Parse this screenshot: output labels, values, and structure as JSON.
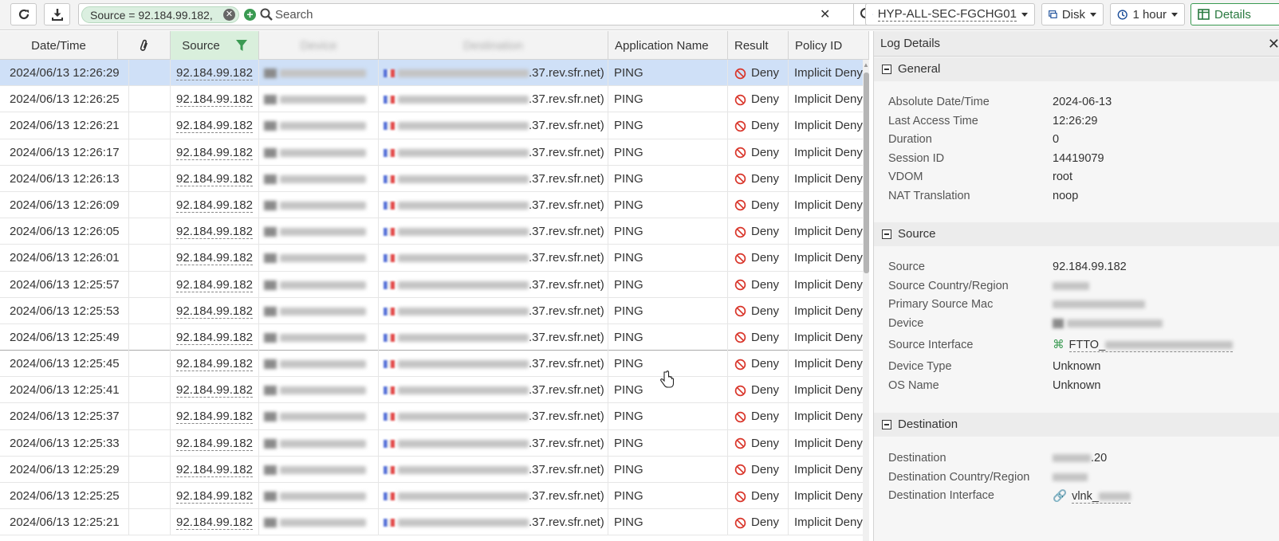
{
  "toolbar": {
    "refresh_icon": "refresh-icon",
    "download_icon": "download-icon",
    "filter_chip": "Source = 92.184.99.182,",
    "search_placeholder": "Search",
    "device_dropdown": "HYP-ALL-SEC-FGCHG01",
    "storage_dropdown": "Disk",
    "time_dropdown": "1 hour",
    "details_button": "Details"
  },
  "table": {
    "columns": {
      "date": "Date/Time",
      "source": "Source",
      "device": "Device",
      "destination": "Destination",
      "application": "Application Name",
      "result": "Result",
      "policy": "Policy ID"
    },
    "rows": [
      {
        "date": "2024/06/13 12:26:29",
        "source": "92.184.99.182",
        "dst_suffix": ".37.rev.sfr.net)",
        "app": "PING",
        "result": "Deny",
        "policy": "Implicit Deny"
      },
      {
        "date": "2024/06/13 12:26:25",
        "source": "92.184.99.182",
        "dst_suffix": ".37.rev.sfr.net)",
        "app": "PING",
        "result": "Deny",
        "policy": "Implicit Deny"
      },
      {
        "date": "2024/06/13 12:26:21",
        "source": "92.184.99.182",
        "dst_suffix": ".37.rev.sfr.net)",
        "app": "PING",
        "result": "Deny",
        "policy": "Implicit Deny"
      },
      {
        "date": "2024/06/13 12:26:17",
        "source": "92.184.99.182",
        "dst_suffix": ".37.rev.sfr.net)",
        "app": "PING",
        "result": "Deny",
        "policy": "Implicit Deny"
      },
      {
        "date": "2024/06/13 12:26:13",
        "source": "92.184.99.182",
        "dst_suffix": ".37.rev.sfr.net)",
        "app": "PING",
        "result": "Deny",
        "policy": "Implicit Deny"
      },
      {
        "date": "2024/06/13 12:26:09",
        "source": "92.184.99.182",
        "dst_suffix": ".37.rev.sfr.net)",
        "app": "PING",
        "result": "Deny",
        "policy": "Implicit Deny"
      },
      {
        "date": "2024/06/13 12:26:05",
        "source": "92.184.99.182",
        "dst_suffix": ".37.rev.sfr.net)",
        "app": "PING",
        "result": "Deny",
        "policy": "Implicit Deny"
      },
      {
        "date": "2024/06/13 12:26:01",
        "source": "92.184.99.182",
        "dst_suffix": ".37.rev.sfr.net)",
        "app": "PING",
        "result": "Deny",
        "policy": "Implicit Deny"
      },
      {
        "date": "2024/06/13 12:25:57",
        "source": "92.184.99.182",
        "dst_suffix": ".37.rev.sfr.net)",
        "app": "PING",
        "result": "Deny",
        "policy": "Implicit Deny"
      },
      {
        "date": "2024/06/13 12:25:53",
        "source": "92.184.99.182",
        "dst_suffix": ".37.rev.sfr.net)",
        "app": "PING",
        "result": "Deny",
        "policy": "Implicit Deny"
      },
      {
        "date": "2024/06/13 12:25:49",
        "source": "92.184.99.182",
        "dst_suffix": ".37.rev.sfr.net)",
        "app": "PING",
        "result": "Deny",
        "policy": "Implicit Deny"
      },
      {
        "date": "2024/06/13 12:25:45",
        "source": "92.184.99.182",
        "dst_suffix": ".37.rev.sfr.net)",
        "app": "PING",
        "result": "Deny",
        "policy": "Implicit Deny"
      },
      {
        "date": "2024/06/13 12:25:41",
        "source": "92.184.99.182",
        "dst_suffix": ".37.rev.sfr.net)",
        "app": "PING",
        "result": "Deny",
        "policy": "Implicit Deny"
      },
      {
        "date": "2024/06/13 12:25:37",
        "source": "92.184.99.182",
        "dst_suffix": ".37.rev.sfr.net)",
        "app": "PING",
        "result": "Deny",
        "policy": "Implicit Deny"
      },
      {
        "date": "2024/06/13 12:25:33",
        "source": "92.184.99.182",
        "dst_suffix": ".37.rev.sfr.net)",
        "app": "PING",
        "result": "Deny",
        "policy": "Implicit Deny"
      },
      {
        "date": "2024/06/13 12:25:29",
        "source": "92.184.99.182",
        "dst_suffix": ".37.rev.sfr.net)",
        "app": "PING",
        "result": "Deny",
        "policy": "Implicit Deny"
      },
      {
        "date": "2024/06/13 12:25:25",
        "source": "92.184.99.182",
        "dst_suffix": ".37.rev.sfr.net)",
        "app": "PING",
        "result": "Deny",
        "policy": "Implicit Deny"
      },
      {
        "date": "2024/06/13 12:25:21",
        "source": "92.184.99.182",
        "dst_suffix": ".37.rev.sfr.net)",
        "app": "PING",
        "result": "Deny",
        "policy": "Implicit Deny"
      }
    ]
  },
  "details": {
    "title": "Log Details",
    "general": {
      "title": "General",
      "items": [
        {
          "k": "Absolute Date/Time",
          "v": "2024-06-13"
        },
        {
          "k": "Last Access Time",
          "v": "12:26:29"
        },
        {
          "k": "Duration",
          "v": "0"
        },
        {
          "k": "Session ID",
          "v": "14419079"
        },
        {
          "k": "VDOM",
          "v": "root"
        },
        {
          "k": "NAT Translation",
          "v": "noop"
        }
      ]
    },
    "source": {
      "title": "Source",
      "items": [
        {
          "k": "Source",
          "v": "92.184.99.182"
        },
        {
          "k": "Source Country/Region",
          "v": ""
        },
        {
          "k": "Primary Source Mac",
          "v": ""
        },
        {
          "k": "Device",
          "v": ""
        },
        {
          "k": "Source Interface",
          "v": "FTTO_"
        },
        {
          "k": "Device Type",
          "v": "Unknown"
        },
        {
          "k": "OS Name",
          "v": "Unknown"
        }
      ]
    },
    "destination": {
      "title": "Destination",
      "items": [
        {
          "k": "Destination",
          "v": ".20"
        },
        {
          "k": "Destination Country/Region",
          "v": ""
        },
        {
          "k": "Destination Interface",
          "v": "vlnk_"
        }
      ]
    }
  },
  "colors": {
    "accent_green": "#3a9a52",
    "selection": "#cfe0f7",
    "deny_red": "#d9362b",
    "brand_blue": "#1d4f9a"
  }
}
